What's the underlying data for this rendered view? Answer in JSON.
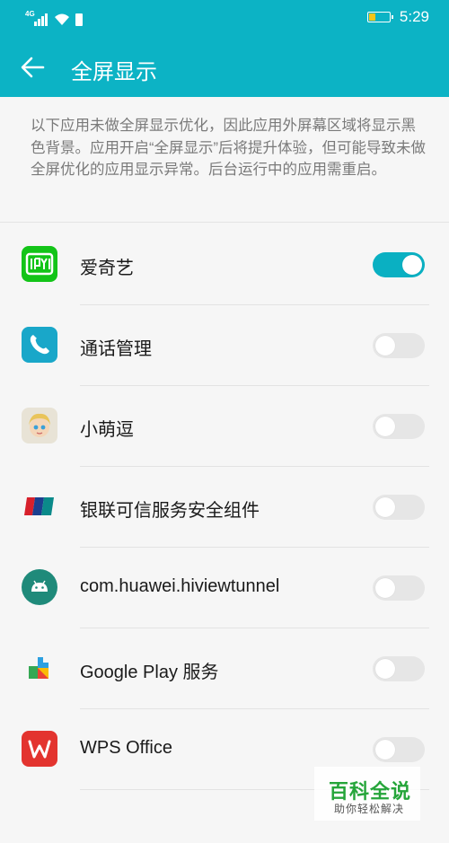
{
  "status_bar": {
    "network": "4G",
    "time": "5:29",
    "battery_level": 0.3
  },
  "toolbar": {
    "title": "全屏显示"
  },
  "description": "以下应用未做全屏显示优化，因此应用外屏幕区域将显示黑色背景。应用开启“全屏显示”后将提升体验，但可能导致未做全屏优化的应用显示异常。后台运行中的应用需重启。",
  "apps": [
    {
      "name": "爱奇艺",
      "icon": "iqiyi-icon",
      "enabled": true
    },
    {
      "name": "通话管理",
      "icon": "phone-icon",
      "enabled": false
    },
    {
      "name": "小萌逗",
      "icon": "xiaomengdou-icon",
      "enabled": false
    },
    {
      "name": "银联可信服务安全组件",
      "icon": "unionpay-icon",
      "enabled": false
    },
    {
      "name": "com.huawei.hiviewtunnel",
      "icon": "android-icon",
      "enabled": false
    },
    {
      "name": "Google Play 服务",
      "icon": "google-play-services-icon",
      "enabled": false
    },
    {
      "name": "WPS Office",
      "icon": "wps-icon",
      "enabled": false
    }
  ],
  "watermark": {
    "title": "百科全说",
    "subtitle": "助你轻松解决"
  },
  "colors": {
    "accent": "#0cb3c5",
    "toggle_on": "#0ab0c2",
    "toggle_off": "#e6e6e6"
  }
}
